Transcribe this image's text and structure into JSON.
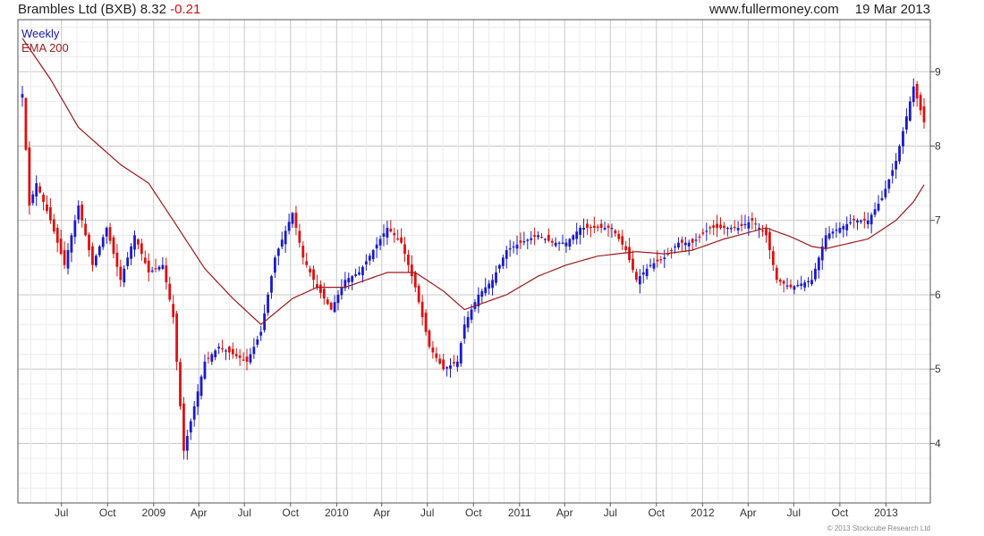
{
  "header": {
    "title": "Brambles Ltd (BXB) 8.32",
    "change": "-0.21",
    "site": "www.fullermoney.com",
    "date": "19 Mar 2013"
  },
  "legend": {
    "period": "Weekly",
    "ma_label": "EMA 200"
  },
  "footer": {
    "copyright": "© 2013 Stockcube Research Ltd"
  },
  "colors": {
    "up": "#1a1acc",
    "down": "#dd1111",
    "ema": "#a01818",
    "grid": "#d7d7d7"
  },
  "chart_data": {
    "type": "candlestick",
    "frequency": "weekly",
    "start": "2008-04-14",
    "end": "2013-03-18",
    "ylim": [
      3.2,
      9.7
    ],
    "y_ticks": [
      4,
      5,
      6,
      7,
      8,
      9
    ],
    "x_ticks": [
      "Jul",
      "Oct",
      "2009",
      "Apr",
      "Jul",
      "Oct",
      "2010",
      "Apr",
      "Jul",
      "Oct",
      "2011",
      "Apr",
      "Jul",
      "Oct",
      "2012",
      "Apr",
      "Jul",
      "Oct",
      "2013"
    ],
    "close_path": [
      [
        "2008-04-14",
        8.7
      ],
      [
        "2008-04-28",
        7.2
      ],
      [
        "2008-05-12",
        7.5
      ],
      [
        "2008-06-09",
        7.0
      ],
      [
        "2008-07-07",
        6.4
      ],
      [
        "2008-08-04",
        7.2
      ],
      [
        "2008-09-01",
        6.4
      ],
      [
        "2008-09-29",
        6.9
      ],
      [
        "2008-10-27",
        6.2
      ],
      [
        "2008-11-24",
        6.8
      ],
      [
        "2008-12-22",
        6.3
      ],
      [
        "2009-01-19",
        6.4
      ],
      [
        "2009-02-09",
        5.7
      ],
      [
        "2009-03-02",
        3.9
      ],
      [
        "2009-03-16",
        4.3
      ],
      [
        "2009-04-13",
        5.1
      ],
      [
        "2009-05-11",
        5.3
      ],
      [
        "2009-06-08",
        5.2
      ],
      [
        "2009-07-06",
        5.1
      ],
      [
        "2009-08-03",
        5.5
      ],
      [
        "2009-08-31",
        6.5
      ],
      [
        "2009-10-05",
        7.1
      ],
      [
        "2009-10-26",
        6.5
      ],
      [
        "2009-11-23",
        6.1
      ],
      [
        "2009-12-21",
        5.8
      ],
      [
        "2010-01-18",
        6.2
      ],
      [
        "2010-02-15",
        6.3
      ],
      [
        "2010-03-15",
        6.6
      ],
      [
        "2010-04-12",
        6.9
      ],
      [
        "2010-05-10",
        6.7
      ],
      [
        "2010-06-07",
        6.1
      ],
      [
        "2010-07-05",
        5.3
      ],
      [
        "2010-08-02",
        5.0
      ],
      [
        "2010-08-30",
        5.1
      ],
      [
        "2010-09-13",
        5.6
      ],
      [
        "2010-10-11",
        6.0
      ],
      [
        "2010-11-08",
        6.2
      ],
      [
        "2010-12-06",
        6.6
      ],
      [
        "2011-01-03",
        6.7
      ],
      [
        "2011-02-07",
        6.8
      ],
      [
        "2011-03-07",
        6.7
      ],
      [
        "2011-04-04",
        6.7
      ],
      [
        "2011-05-02",
        6.9
      ],
      [
        "2011-06-06",
        6.9
      ],
      [
        "2011-07-04",
        6.9
      ],
      [
        "2011-08-01",
        6.6
      ],
      [
        "2011-08-22",
        6.2
      ],
      [
        "2011-09-19",
        6.4
      ],
      [
        "2011-10-17",
        6.5
      ],
      [
        "2011-11-14",
        6.7
      ],
      [
        "2011-12-12",
        6.7
      ],
      [
        "2012-01-16",
        6.9
      ],
      [
        "2012-02-13",
        6.9
      ],
      [
        "2012-03-12",
        6.9
      ],
      [
        "2012-04-09",
        7.0
      ],
      [
        "2012-05-07",
        6.8
      ],
      [
        "2012-05-28",
        6.2
      ],
      [
        "2012-06-25",
        6.1
      ],
      [
        "2012-08-06",
        6.2
      ],
      [
        "2012-09-03",
        6.8
      ],
      [
        "2012-10-01",
        6.9
      ],
      [
        "2012-10-29",
        7.0
      ],
      [
        "2012-11-26",
        7.0
      ],
      [
        "2012-12-24",
        7.3
      ],
      [
        "2013-01-21",
        7.8
      ],
      [
        "2013-02-11",
        8.4
      ],
      [
        "2013-02-25",
        8.8
      ],
      [
        "2013-03-18",
        8.32
      ]
    ],
    "ema_200": [
      [
        "2008-04-14",
        9.45
      ],
      [
        "2008-06-09",
        8.9
      ],
      [
        "2008-08-04",
        8.25
      ],
      [
        "2008-10-27",
        7.75
      ],
      [
        "2008-12-22",
        7.5
      ],
      [
        "2009-02-09",
        7.0
      ],
      [
        "2009-04-13",
        6.35
      ],
      [
        "2009-06-08",
        5.95
      ],
      [
        "2009-08-03",
        5.6
      ],
      [
        "2009-10-05",
        5.95
      ],
      [
        "2009-11-23",
        6.1
      ],
      [
        "2010-01-18",
        6.1
      ],
      [
        "2010-04-12",
        6.3
      ],
      [
        "2010-06-07",
        6.3
      ],
      [
        "2010-08-02",
        6.05
      ],
      [
        "2010-09-13",
        5.8
      ],
      [
        "2010-12-06",
        6.0
      ],
      [
        "2011-02-07",
        6.25
      ],
      [
        "2011-04-04",
        6.4
      ],
      [
        "2011-06-06",
        6.52
      ],
      [
        "2011-08-22",
        6.58
      ],
      [
        "2011-10-17",
        6.55
      ],
      [
        "2011-12-12",
        6.6
      ],
      [
        "2012-02-13",
        6.75
      ],
      [
        "2012-05-07",
        6.9
      ],
      [
        "2012-06-25",
        6.78
      ],
      [
        "2012-08-06",
        6.65
      ],
      [
        "2012-09-03",
        6.62
      ],
      [
        "2012-11-26",
        6.75
      ],
      [
        "2013-01-21",
        7.0
      ],
      [
        "2013-02-25",
        7.25
      ],
      [
        "2013-03-18",
        7.48
      ]
    ]
  }
}
